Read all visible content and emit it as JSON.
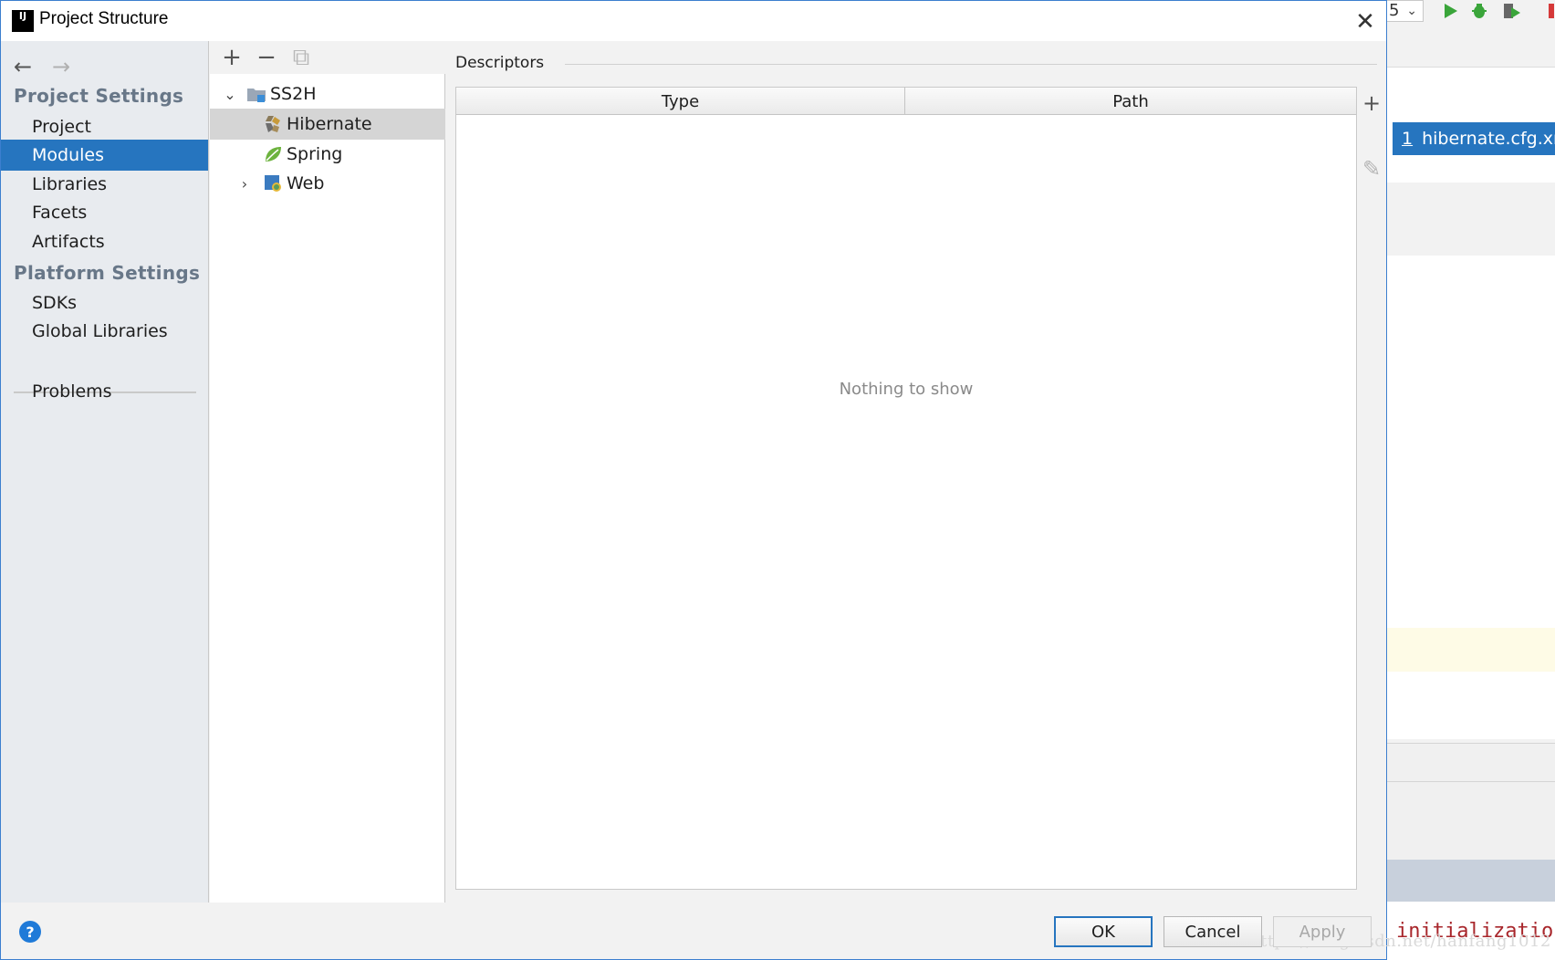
{
  "dialog": {
    "title": "Project Structure",
    "close_glyph": "✕"
  },
  "nav": {
    "back_glyph": "←",
    "forward_glyph": "→",
    "sections": [
      {
        "heading": "Project Settings",
        "items": [
          "Project",
          "Modules",
          "Libraries",
          "Facets",
          "Artifacts"
        ]
      },
      {
        "heading": "Platform Settings",
        "items": [
          "SDKs",
          "Global Libraries"
        ]
      }
    ],
    "selected": "Modules",
    "problems": "Problems"
  },
  "tree": {
    "toolbar": {
      "add": "+",
      "remove": "−",
      "copy": "⧉"
    },
    "nodes": [
      {
        "label": "SS2H",
        "icon": "module-folder-icon",
        "expanded": true
      },
      {
        "label": "Hibernate",
        "icon": "hibernate-icon",
        "selected": true
      },
      {
        "label": "Spring",
        "icon": "spring-leaf-icon"
      },
      {
        "label": "Web",
        "icon": "web-module-icon",
        "expanded": false
      }
    ]
  },
  "descriptors": {
    "label": "Descriptors",
    "columns": [
      "Type",
      "Path"
    ],
    "empty_text": "Nothing to show",
    "add_glyph": "+",
    "edit_glyph": "✎"
  },
  "footer": {
    "help_glyph": "?",
    "ok": "OK",
    "cancel": "Cancel",
    "apply": "Apply",
    "watermark": "https://blog.csdn.net/hanfang1012"
  },
  "ide": {
    "combo_value": "5",
    "open_file_index": "1",
    "open_file_name": "hibernate.cfg.xml",
    "console_text": "initialization",
    "colors": {
      "selection": "#2675bf",
      "console_text": "#a8262b",
      "run_green": "#3aa53a"
    }
  }
}
